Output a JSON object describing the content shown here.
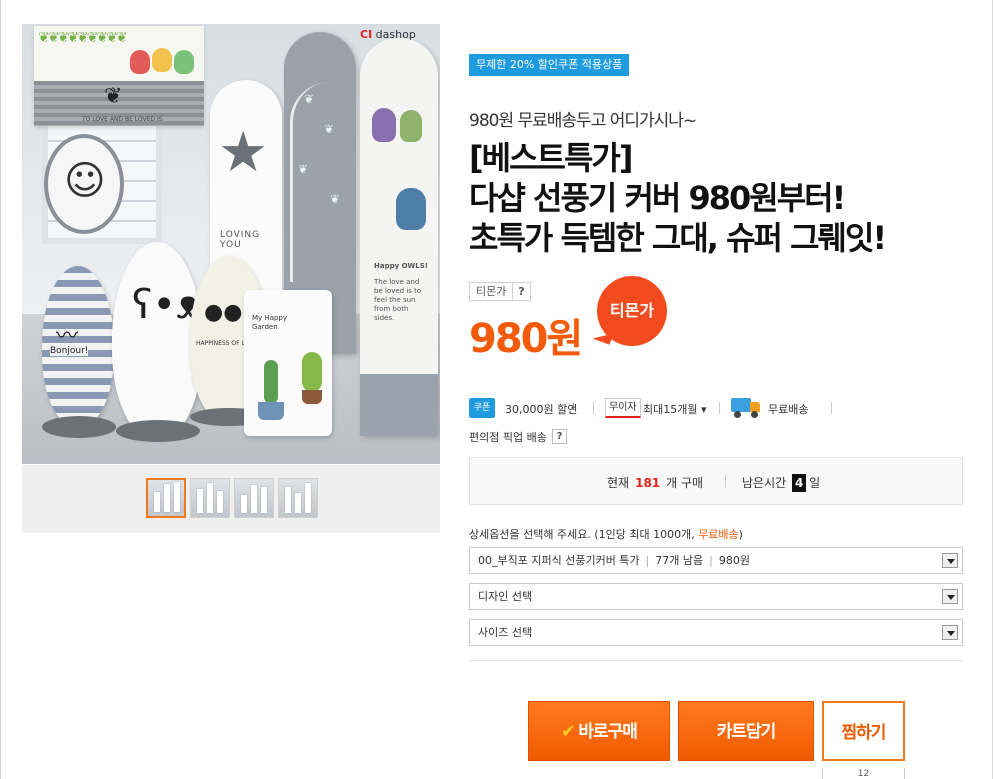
{
  "product_image": {
    "brand_logo_prefix": "CI",
    "brand_logo_text": "dashop",
    "ac_cover_text": "TO LOVE AND BE LOVED IS",
    "white_tower_text": "LOVING YOU",
    "owl_tower_heading": "Happy OWLS!",
    "owl_tower_text": "The love and be loved is to feel the sun from both sides.",
    "stripe_fan_text": "Bonjour!",
    "owl_fan_text": "HAPPINESS OF LIFE",
    "box_fan_text": "My Happy Garden"
  },
  "thumbnails": [
    {
      "label": "thumb-1",
      "active": true
    },
    {
      "label": "thumb-2",
      "active": false
    },
    {
      "label": "thumb-3",
      "active": false
    },
    {
      "label": "thumb-4",
      "active": false
    }
  ],
  "coupon_badge": "무제한 20% 할인쿠폰 적용상품",
  "subtitle": "980원 무료배송두고 어디가시나~",
  "title_lines": [
    "[베스트특가]",
    "다샵 선풍기 커버 980원부터!",
    "초특가 득템한 그대, 슈퍼 그뤠잇!"
  ],
  "price": {
    "label": "티몬가",
    "help": "?",
    "value": "980원",
    "badge": "티몬가"
  },
  "benefits": {
    "coupon_icon": "쿠폰",
    "coupon_text": "30,000원 할인",
    "no_interest_tag": "무이자",
    "installment": "최대15개월 ▾",
    "shipping": "무료배송"
  },
  "pickup": {
    "text": "편의점 픽업 배송",
    "help": "?"
  },
  "status": {
    "now_label": "현재",
    "now_count": "181",
    "now_unit": "개 구매",
    "left_label": "남은시간",
    "left_days": "4",
    "left_unit": "일"
  },
  "option_guide": {
    "text": "상세옵션을 선택해 주세요. (1인당 최대 1000개, ",
    "free": "무료배송",
    "close": ")"
  },
  "selects": [
    {
      "name": "00_부직포 지퍼식 선풍기커버 특가",
      "stock": "77개 남음",
      "price": "980원"
    },
    {
      "label": "디자인 선택"
    },
    {
      "label": "사이즈 선택"
    }
  ],
  "buttons": {
    "buy": "바로구매",
    "buy_icon": "✔",
    "cart": "카트담기",
    "wish": "찜하기",
    "wish_count": "12"
  },
  "colors": {
    "accent_orange": "#f05a00",
    "price_orange": "#f35b0a",
    "coupon_blue": "#1f9be0",
    "badge_red": "#f24b1f"
  }
}
